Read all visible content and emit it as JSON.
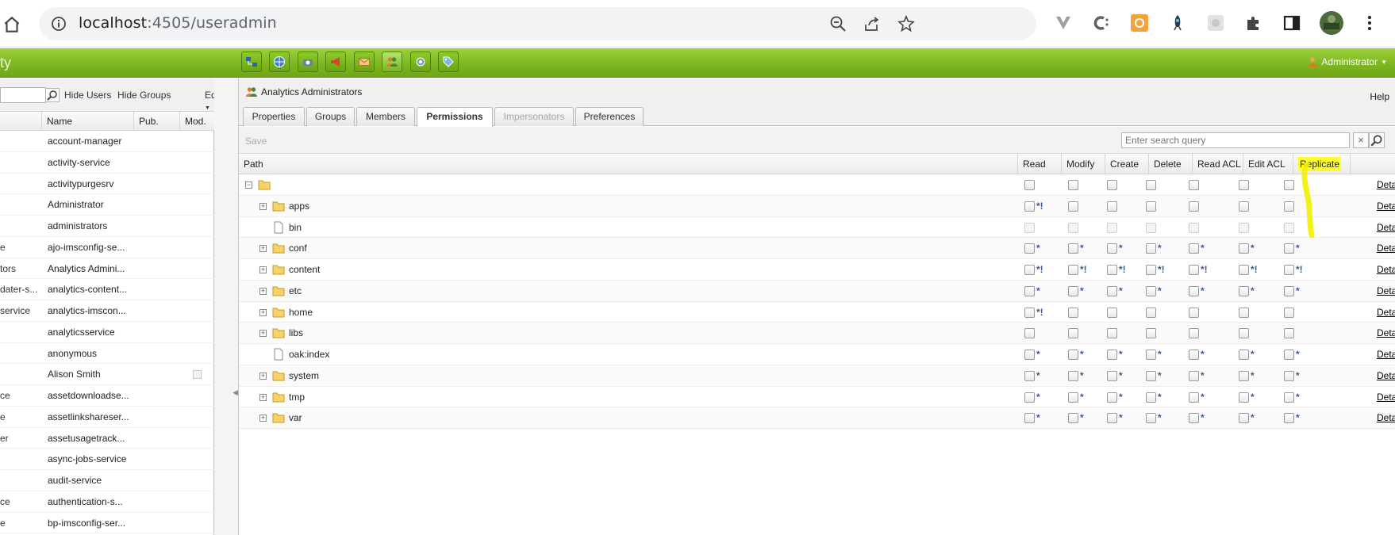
{
  "browser": {
    "url_host": "localhost",
    "url_rest": ":4505/useradmin",
    "extensions": [
      "v-extension-icon",
      "c-extension-icon",
      "orange-extension-icon",
      "rocket-extension-icon",
      "grey-extension-icon",
      "puzzle-icon",
      "sidebar-icon",
      "profile-avatar",
      "kebab-menu-icon"
    ]
  },
  "app": {
    "title_fragment": "ty",
    "user_menu": "Administrator"
  },
  "left": {
    "hide_users": "Hide Users",
    "hide_groups": "Hide Groups",
    "edit": "Edit",
    "columns": [
      "Name",
      "Pub.",
      "Mod."
    ],
    "rows": [
      {
        "frag": "",
        "name": "account-manager"
      },
      {
        "frag": "",
        "name": "activity-service"
      },
      {
        "frag": "",
        "name": "activitypurgesrv"
      },
      {
        "frag": "",
        "name": "Administrator"
      },
      {
        "frag": "",
        "name": "administrators"
      },
      {
        "frag": "e",
        "name": "ajo-imsconfig-se..."
      },
      {
        "frag": "tors",
        "name": "Analytics Admini..."
      },
      {
        "frag": "dater-s...",
        "name": "analytics-content..."
      },
      {
        "frag": "service",
        "name": "analytics-imscon..."
      },
      {
        "frag": "",
        "name": "analyticsservice"
      },
      {
        "frag": "",
        "name": "anonymous"
      },
      {
        "frag": "",
        "name": "Alison Smith"
      },
      {
        "frag": "ce",
        "name": "assetdownloadse..."
      },
      {
        "frag": "e",
        "name": "assetlinkshareser..."
      },
      {
        "frag": "er",
        "name": "assetusagetrack..."
      },
      {
        "frag": "",
        "name": "async-jobs-service"
      },
      {
        "frag": "",
        "name": "audit-service"
      },
      {
        "frag": "ce",
        "name": "authentication-s..."
      },
      {
        "frag": "e",
        "name": "bp-imsconfig-ser..."
      }
    ]
  },
  "right": {
    "group_title": "Analytics Administrators",
    "help": "Help",
    "tabs": [
      "Properties",
      "Groups",
      "Members",
      "Permissions",
      "Impersonators",
      "Preferences"
    ],
    "save": "Save",
    "search_placeholder": "Enter search query",
    "columns": [
      "Path",
      "Read",
      "Modify",
      "Create",
      "Delete",
      "Read ACL",
      "Edit ACL",
      "Replicate"
    ],
    "details_label": "Details",
    "rows": [
      {
        "name": "",
        "expand": "-",
        "type": "folder",
        "level": 0,
        "marks": [
          "",
          "",
          "",
          "",
          "",
          "",
          ""
        ],
        "disabled": false
      },
      {
        "name": "apps",
        "expand": "+",
        "type": "folder",
        "level": 1,
        "marks": [
          "*!",
          "",
          "",
          "",
          "",
          "",
          ""
        ],
        "disabled": false
      },
      {
        "name": "bin",
        "expand": "",
        "type": "file",
        "level": 1,
        "marks": [
          "",
          "",
          "",
          "",
          "",
          "",
          ""
        ],
        "disabled": true
      },
      {
        "name": "conf",
        "expand": "+",
        "type": "folder",
        "level": 1,
        "marks": [
          "*",
          "*",
          "*",
          "*",
          "*",
          "*",
          "*"
        ],
        "disabled": false
      },
      {
        "name": "content",
        "expand": "+",
        "type": "folder",
        "level": 1,
        "marks": [
          "*!",
          "*!",
          "*!",
          "*!",
          "*!",
          "*!",
          "*!"
        ],
        "disabled": false
      },
      {
        "name": "etc",
        "expand": "+",
        "type": "folder",
        "level": 1,
        "marks": [
          "*",
          "*",
          "*",
          "*",
          "*",
          "*",
          "*"
        ],
        "disabled": false
      },
      {
        "name": "home",
        "expand": "+",
        "type": "folder",
        "level": 1,
        "marks": [
          "*!",
          "",
          "",
          "",
          "",
          "",
          ""
        ],
        "disabled": false
      },
      {
        "name": "libs",
        "expand": "+",
        "type": "folder",
        "level": 1,
        "marks": [
          "",
          "",
          "",
          "",
          "",
          "",
          ""
        ],
        "disabled": false
      },
      {
        "name": "oak:index",
        "expand": "",
        "type": "file",
        "level": 1,
        "marks": [
          "*",
          "*",
          "*",
          "*",
          "*",
          "*",
          "*"
        ],
        "disabled": false
      },
      {
        "name": "system",
        "expand": "+",
        "type": "folder",
        "level": 1,
        "marks": [
          "*",
          "*",
          "*",
          "*",
          "*",
          "*",
          "*"
        ],
        "disabled": false
      },
      {
        "name": "tmp",
        "expand": "+",
        "type": "folder",
        "level": 1,
        "marks": [
          "*",
          "*",
          "*",
          "*",
          "*",
          "*",
          "*"
        ],
        "disabled": false
      },
      {
        "name": "var",
        "expand": "+",
        "type": "folder",
        "level": 1,
        "marks": [
          "*",
          "*",
          "*",
          "*",
          "*",
          "*",
          "*"
        ],
        "disabled": false
      }
    ]
  },
  "colors": {
    "accent_green": "#7cb520",
    "highlight_yellow": "#ffff33",
    "mark_blue": "#3a5a8c"
  }
}
